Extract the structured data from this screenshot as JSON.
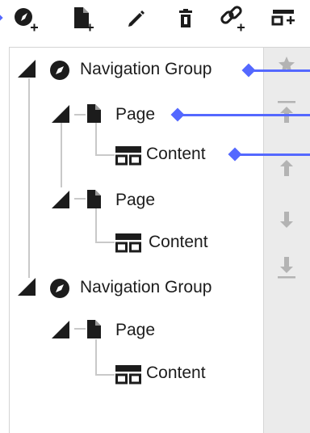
{
  "toolbar": {
    "buttons": [
      {
        "name": "add-navigation-group",
        "icon": "compass-plus-icon"
      },
      {
        "name": "add-page",
        "icon": "page-plus-icon"
      },
      {
        "name": "edit",
        "icon": "pencil-icon"
      },
      {
        "name": "delete",
        "icon": "trash-icon"
      },
      {
        "name": "add-link",
        "icon": "link-plus-icon"
      },
      {
        "name": "add-content",
        "icon": "content-plus-icon"
      }
    ]
  },
  "tree": [
    {
      "type": "navigation-group",
      "label": "Navigation Group",
      "icon": "compass-icon"
    },
    {
      "type": "page",
      "label": "Page",
      "icon": "page-icon"
    },
    {
      "type": "content",
      "label": "Content",
      "icon": "content-icon"
    },
    {
      "type": "page",
      "label": "Page",
      "icon": "page-icon"
    },
    {
      "type": "content",
      "label": "Content",
      "icon": "content-icon"
    },
    {
      "type": "navigation-group",
      "label": "Navigation Group",
      "icon": "compass-icon"
    },
    {
      "type": "page",
      "label": "Page",
      "icon": "page-icon"
    },
    {
      "type": "content",
      "label": "Content",
      "icon": "content-icon"
    }
  ],
  "side_actions": [
    {
      "name": "star",
      "icon": "star-icon"
    },
    {
      "name": "move-to-top",
      "icon": "arrow-to-top-icon"
    },
    {
      "name": "move-up",
      "icon": "arrow-up-icon"
    },
    {
      "name": "move-down",
      "icon": "arrow-down-icon"
    },
    {
      "name": "move-to-bottom",
      "icon": "arrow-to-bottom-icon"
    }
  ],
  "colors": {
    "accent": "#5468ff",
    "icon": "#1c1c1c",
    "tree_line": "#c9c9c9",
    "side_background": "#ebebeb",
    "side_icon": "#b3b3b3"
  }
}
